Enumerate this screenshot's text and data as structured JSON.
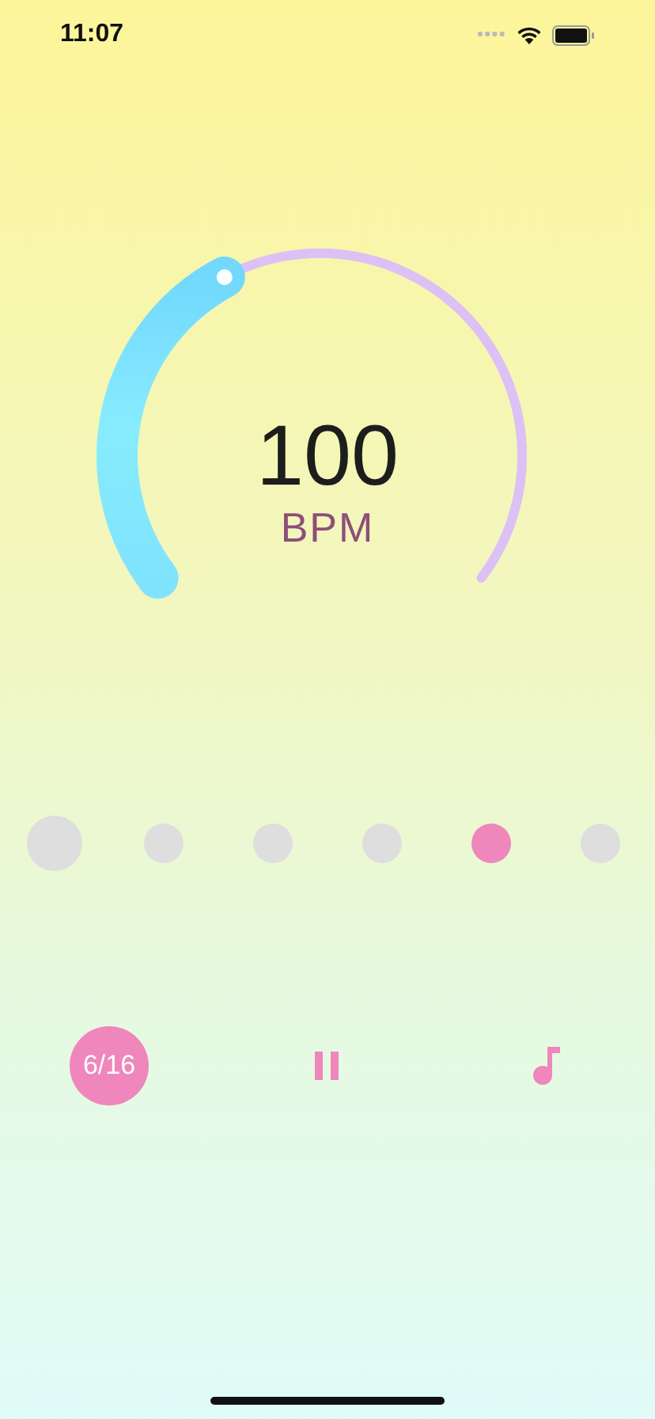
{
  "status_bar": {
    "time": "11:07"
  },
  "tempo": {
    "value": "100",
    "unit": "BPM"
  },
  "beats": [
    {
      "accent": true,
      "selected": false
    },
    {
      "accent": false,
      "selected": false
    },
    {
      "accent": false,
      "selected": false
    },
    {
      "accent": false,
      "selected": false
    },
    {
      "accent": false,
      "selected": true
    },
    {
      "accent": false,
      "selected": false
    }
  ],
  "controls": {
    "counter": "6/16",
    "playing": true
  }
}
